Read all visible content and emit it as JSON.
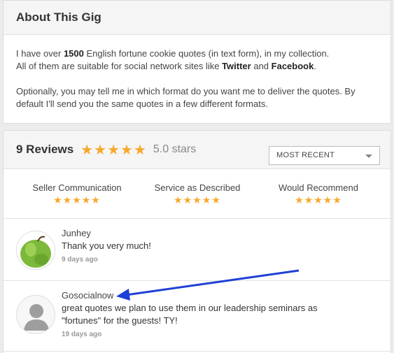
{
  "about": {
    "title": "About This Gig",
    "line1_a": "I have over ",
    "line1_b": "1500",
    "line1_c": " English fortune cookie quotes (in text form), in my collection.",
    "line2_a": "All of them are suitable for social network sites like ",
    "line2_b": "Twitter",
    "line2_c": " and ",
    "line2_d": "Facebook",
    "line2_e": ".",
    "para2": "Optionally, you may tell me in which format do you want me to deliver the quotes. By default I'll send you the same quotes in a few different formats."
  },
  "reviews": {
    "title": "9 Reviews",
    "stars": "★★★★★",
    "rating_text": "5.0 stars",
    "sort_label": "MOST RECENT",
    "categories": [
      {
        "label": "Seller Communication",
        "stars": "★★★★★",
        "rating": 5
      },
      {
        "label": "Service as Described",
        "stars": "★★★★★",
        "rating": 5
      },
      {
        "label": "Would Recommend",
        "stars": "★★★★★",
        "rating": 5
      }
    ],
    "items": [
      {
        "name": "Junhey",
        "text": "Thank you very much!",
        "date": "9 days ago",
        "avatar": "green-apple"
      },
      {
        "name": "Gosocialnow",
        "text": "great quotes we plan to use them in our leadership seminars as \"fortunes\" for the guests! TY!",
        "date": "19 days ago",
        "avatar": "default-user-silhouette"
      }
    ]
  },
  "colors": {
    "star": "#f9a72b",
    "arrow": "#1f3fd6"
  }
}
